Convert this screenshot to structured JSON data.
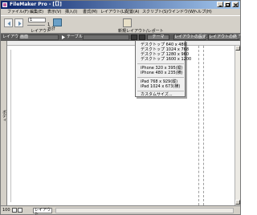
{
  "window": {
    "title": "FileMaker Pro - [【】]"
  },
  "menubar": {
    "items": [
      "ファイル(F)",
      "編集(E)",
      "表示(V)",
      "挿入(I)",
      "書式(M)",
      "レイアウト(L)",
      "配置(A)",
      "スクリプト(S)",
      "ウインドウ(W)",
      "ヘルプ(H)"
    ]
  },
  "toolbar": {
    "layout_number": "1",
    "layout_label": "レイアウト",
    "total_label": "1\n合計",
    "new_layout_label": "新規レイアウト/レポート"
  },
  "layoutbar": {
    "layout_label": "レイアウト:",
    "layout_value": "画面",
    "table_label": "テーブル:",
    "table_value": "画面",
    "theme_button": "テーマ",
    "layout_settings_button": "レイアウトの設定...",
    "exit_layout_button": "レイアウトの終了"
  },
  "left_strip": {
    "label": "ボディ"
  },
  "statusbar": {
    "zoom": "100",
    "mode": "レイアウト"
  },
  "dropdown": {
    "items": [
      "デスクトップ 640 x 480",
      "デスクトップ 1024 x 768",
      "デスクトップ 1280 x 960",
      "デスクトップ 1600 x 1200",
      "iPhone 320 x 395(縦)",
      "iPhone 480 x 235(横)",
      "iPad 768 x 929(縦)",
      "iPad 1024 x 673(横)",
      "カスタムサイズ..."
    ]
  },
  "colors": {
    "titlebar_start": "#0a246a",
    "titlebar_end": "#a6caf0",
    "layoutbar": "#5a5a5a",
    "window": "#d4d0c8"
  },
  "icons": {
    "app": "filemaker-icon",
    "minimize": "minimize-icon",
    "maximize": "maximize-icon",
    "close": "close-icon",
    "back": "arrow-left-icon",
    "forward": "arrow-right-icon",
    "new_layout": "new-layout-icon",
    "desktop": "desktop-icon",
    "device": "device-icon"
  }
}
